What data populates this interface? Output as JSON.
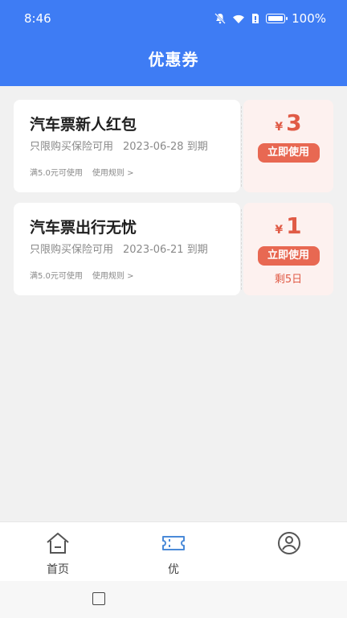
{
  "status_bar": {
    "time": "8:46",
    "battery": "100%",
    "icons": [
      "mute-bell-icon",
      "wifi-icon",
      "sim-icon",
      "battery-icon"
    ]
  },
  "header": {
    "title": "优惠券"
  },
  "coupons": [
    {
      "name": "汽车票新人红包",
      "scope": "只限购买保险可用",
      "expiry": "2023-06-28 到期",
      "condition": "满5.0元可使用",
      "rules": "使用规则 >",
      "currency": "¥",
      "amount": "3",
      "button": "立即使用",
      "remaining": ""
    },
    {
      "name": "汽车票出行无忧",
      "scope": "只限购买保险可用",
      "expiry": "2023-06-21 到期",
      "condition": "满5.0元可使用",
      "rules": "使用规则 >",
      "currency": "¥",
      "amount": "1",
      "button": "立即使用",
      "remaining": "剩5日"
    }
  ],
  "tabbar": {
    "items": [
      {
        "label": "首页",
        "icon": "home-icon"
      },
      {
        "label": "优",
        "icon": "ticket-icon",
        "active": true
      },
      {
        "label": "",
        "icon": "user-circle-icon"
      }
    ]
  },
  "colors": {
    "header": "#3e7cf4",
    "accent": "#e86852",
    "coupon_right_bg": "#fdf1ef"
  }
}
